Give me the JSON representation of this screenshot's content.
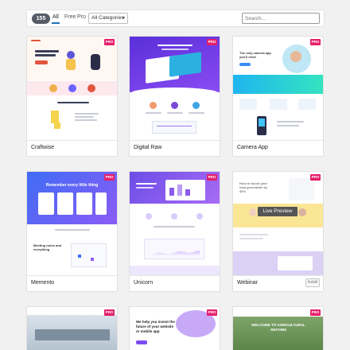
{
  "filter": {
    "count": "155",
    "tabs": [
      "All",
      "Free",
      "Pro"
    ],
    "category_value": "All Categories",
    "search_placeholder": "Search..."
  },
  "templates": [
    {
      "title": "Craftwise",
      "pro": "PRO"
    },
    {
      "title": "Digital Raw",
      "pro": "PRO"
    },
    {
      "title": "Camera App",
      "pro": "PRO"
    },
    {
      "title": "Memento",
      "pro": "PRO"
    },
    {
      "title": "Unicorn",
      "pro": "PRO"
    },
    {
      "title": "Webinar",
      "pro": "PRO"
    },
    {
      "title": "",
      "pro": "PRO"
    },
    {
      "title": "",
      "pro": "PRO"
    },
    {
      "title": "",
      "pro": "PRO"
    }
  ],
  "preview_texts": {
    "camera_heading": "The only camera app you'll need",
    "memento_heading": "Remember every little thing",
    "memento_sub": "Meeting notes and everything",
    "webinar_heading": "How to boost your lead generation by 40%",
    "bottom_mid_heading": "We help you invent the future of your website or mobile app",
    "bottom_right_heading": "WELCOME TO AGRICULTURAL REFORM"
  },
  "actions": {
    "live_preview": "Live Preview",
    "install": "Install"
  },
  "colors": {
    "pro_badge": "#e51f6a",
    "active_tab_underline": "#2271b1",
    "digital_raw_purple": "#6a3de8",
    "memento_blue": "#3f6cf5",
    "unicorn_purple": "#8a5cf0",
    "webinar_yellow": "#f9d95c"
  }
}
